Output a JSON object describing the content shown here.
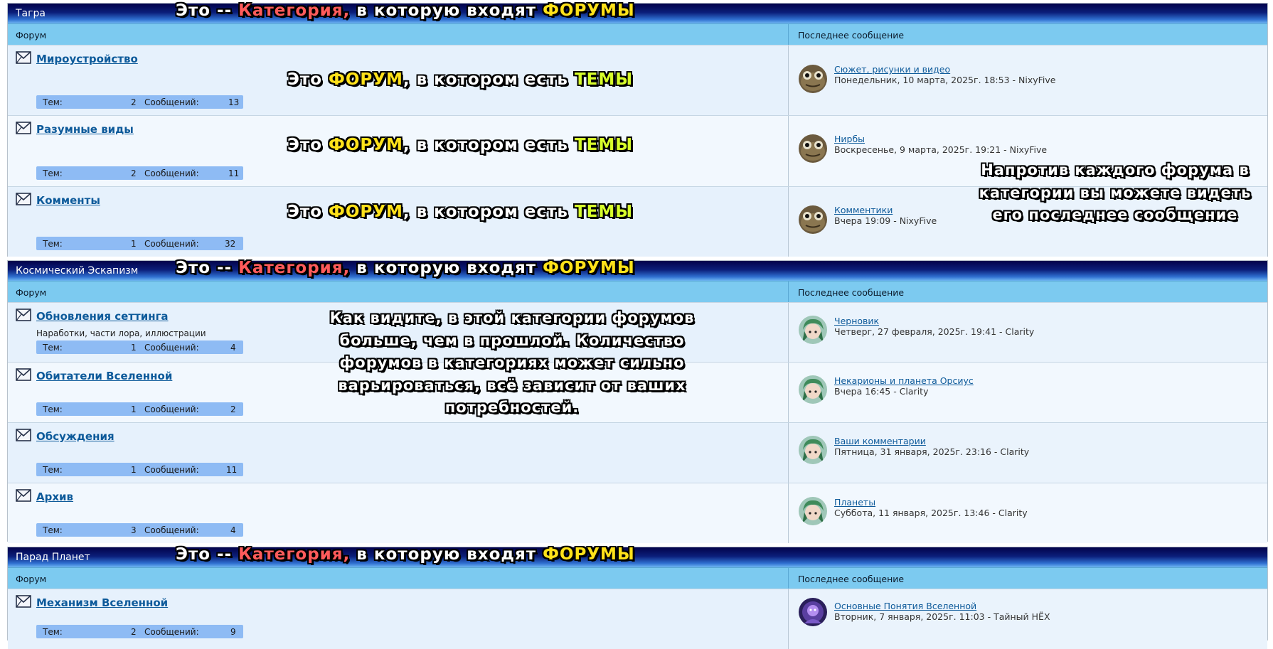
{
  "columns": {
    "forum": "Форум",
    "last": "Последнее сообщение"
  },
  "stats_labels": {
    "topics": "Тем:",
    "posts": "Сообщений:"
  },
  "overlays": {
    "category": {
      "pre": "Это -- ",
      "cat": "Категория,",
      "mid": " в которую входят ",
      "forums": "ФОРУМЫ"
    },
    "forum": {
      "pre": "Это ",
      "forum": "ФОРУМ",
      "mid": ", в котором есть ",
      "topics": "ТЕМЫ"
    },
    "last_note": "Напротив каждого форума в категории вы можете видеть его последнее сообщение",
    "category_note": "Как видите, в этой категории форумов больше, чем в прошлой. Количество форумов в категориях может сильно варьироваться, всё зависит от ваших потребностей."
  },
  "categories": [
    {
      "title": "Тагра",
      "forums": [
        {
          "name": "Мироустройство",
          "desc": "",
          "topics": "2",
          "posts": "13",
          "last_title": "Сюжет, рисунки и видео",
          "last_meta": "Понедельник, 10 марта, 2025г. 18:53 - NixyFive",
          "avatar": "toad-avatar"
        },
        {
          "name": "Разумные виды",
          "desc": "",
          "topics": "2",
          "posts": "11",
          "last_title": "Нирбы",
          "last_meta": "Воскресенье, 9 марта, 2025г. 19:21 - NixyFive",
          "avatar": "toad-avatar"
        },
        {
          "name": "Комменты",
          "desc": "",
          "topics": "1",
          "posts": "32",
          "last_title": "Комментики",
          "last_meta": "Вчера 19:09 - NixyFive",
          "avatar": "toad-avatar"
        }
      ]
    },
    {
      "title": "Космический Эскапизм",
      "forums": [
        {
          "name": "Обновления сеттинга",
          "desc": "Наработки, части лора, иллюстрации",
          "topics": "1",
          "posts": "4",
          "last_title": "Черновик",
          "last_meta": "Четверг, 27 февраля, 2025г. 19:41 - Clarity",
          "avatar": "green-hair-avatar"
        },
        {
          "name": "Обитатели Вселенной",
          "desc": "",
          "topics": "1",
          "posts": "2",
          "last_title": "Некарионы и планета Орсиус",
          "last_meta": "Вчера 16:45 - Clarity",
          "avatar": "green-hair-avatar"
        },
        {
          "name": "Обсуждения",
          "desc": "",
          "topics": "1",
          "posts": "11",
          "last_title": "Ваши комментарии",
          "last_meta": "Пятница, 31 января, 2025г. 23:16 - Clarity",
          "avatar": "green-hair-avatar"
        },
        {
          "name": "Архив",
          "desc": "",
          "topics": "3",
          "posts": "4",
          "last_title": "Планеты",
          "last_meta": "Суббота, 11 января, 2025г. 13:46 - Clarity",
          "avatar": "green-hair-avatar"
        }
      ]
    },
    {
      "title": "Парад Планет",
      "forums": [
        {
          "name": "Механизм Вселенной",
          "desc": "",
          "topics": "2",
          "posts": "9",
          "last_title": "Основные Понятия Вселенной",
          "last_meta": "Вторник, 7 января, 2025г. 11:03 - Тайный НЁХ",
          "avatar": "purple-avatar"
        }
      ]
    }
  ],
  "colors": {
    "header_dark": "#02024a",
    "header_light": "#6fb6f2",
    "column_header": "#7ccaf0",
    "stats_bar": "#8ebbf4",
    "link": "#0d5a9a"
  }
}
